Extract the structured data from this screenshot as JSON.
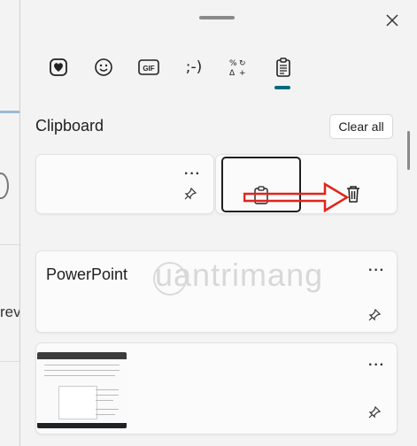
{
  "tabs": [
    {
      "name": "emoji"
    },
    {
      "name": "kaomoji-face"
    },
    {
      "name": "gif",
      "label": "GIF"
    },
    {
      "name": "kaomoji",
      "label": ";-)"
    },
    {
      "name": "symbols"
    },
    {
      "name": "clipboard",
      "active": true
    }
  ],
  "clipboard": {
    "title": "Clipboard",
    "clear_all": "Clear all",
    "more_label": "···",
    "items": [
      {
        "type": "empty"
      },
      {
        "type": "text",
        "text": "PowerPoint"
      },
      {
        "type": "image"
      }
    ]
  },
  "background": {
    "text": "rev"
  },
  "watermark": "uantrimang",
  "colors": {
    "accent": "#006b7d",
    "arrow": "#e2231a"
  }
}
